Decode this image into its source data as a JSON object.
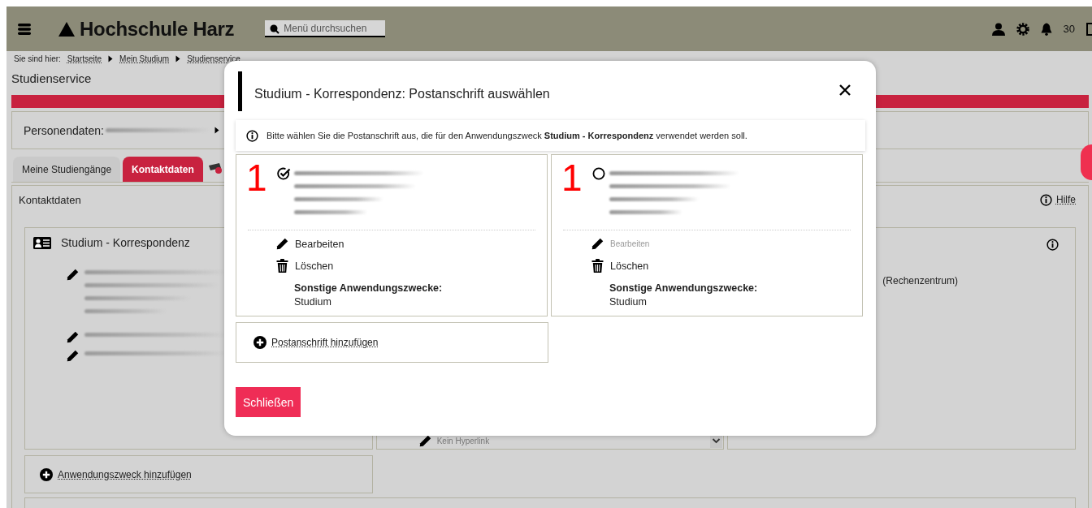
{
  "header": {
    "logo": "Hochschule Harz",
    "search": {
      "placeholder": "Menü durchsuchen"
    },
    "notification_count": "30"
  },
  "breadcrumb": {
    "label": "Sie sind hier:",
    "items": [
      "Startseite",
      "Mein Studium",
      "Studienservice"
    ]
  },
  "page_title": "Studienservice",
  "person_panel": {
    "label": "Personendaten:"
  },
  "tabs": [
    {
      "label": "Meine Studiengänge",
      "selected": false
    },
    {
      "label": "Kontaktdaten",
      "selected": true
    }
  ],
  "content": {
    "title": "Kontaktdaten",
    "help": "Hilfe",
    "card_title": "Studium - Korrespondenz",
    "link_field": "Kein Hyperlink",
    "right_text": "(Rechenzentrum)",
    "add_link": "Anwendungszweck hinzufügen"
  },
  "dialog": {
    "title": "Studium - Korrespondenz: Postanschrift auswählen",
    "info": "Bitte wählen Sie die Postanschrift aus, die für den Anwendungszweck **Studium - Korrespondenz** verwendet werden soll.",
    "addresses": [
      {
        "number": "1",
        "selected": true,
        "edit": "Bearbeiten",
        "edit_disabled": false,
        "delete": "Löschen",
        "other_label": "Sonstige Anwendungszwecke:",
        "other_value": "Studium"
      },
      {
        "number": "1",
        "selected": false,
        "edit": "Bearbeiten",
        "edit_disabled": true,
        "delete": "Löschen",
        "other_label": "Sonstige Anwendungszwecke:",
        "other_value": "Studium"
      }
    ],
    "add_link": "Postanschrift hinzufügen",
    "close_button": "Schließen"
  }
}
